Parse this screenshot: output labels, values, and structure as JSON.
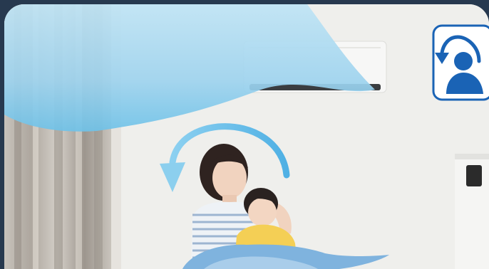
{
  "scene": {
    "subject": "mother-and-child-under-air-conditioner"
  },
  "badge": {
    "icon": "person-airflow-icon"
  },
  "airflow_arrow": {
    "icon": "rotating-arrow-icon"
  },
  "colors": {
    "frame_background": "#27394f",
    "airflow_blue": "#7cc6ea",
    "badge_blue": "#1a63b5",
    "wall": "#efefec"
  }
}
